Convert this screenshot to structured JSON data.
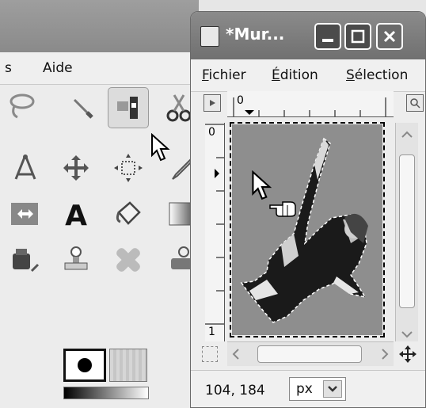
{
  "toolbox": {
    "menu": {
      "partial_left": "s",
      "aide": "Aide"
    },
    "tools": [
      "lasso-icon",
      "paintbrush-icon",
      "align-icon",
      "scissors-icon",
      "measure-icon",
      "move-icon",
      "transform-icon",
      "pen-icon",
      "flip-icon",
      "text-icon",
      "bucket-fill-icon",
      "gradient-icon",
      "ink-icon",
      "clone-icon",
      "heal-icon",
      "stamp-icon"
    ]
  },
  "image_window": {
    "title": "*Mur...",
    "menu": {
      "fichier": "Fichier",
      "edition": "Édition",
      "selection": "Sélection"
    },
    "ruler": {
      "top_zero": "0",
      "left_zero": "0",
      "left_one": "1"
    },
    "status": {
      "coords": "104, 184",
      "unit": "px"
    }
  }
}
